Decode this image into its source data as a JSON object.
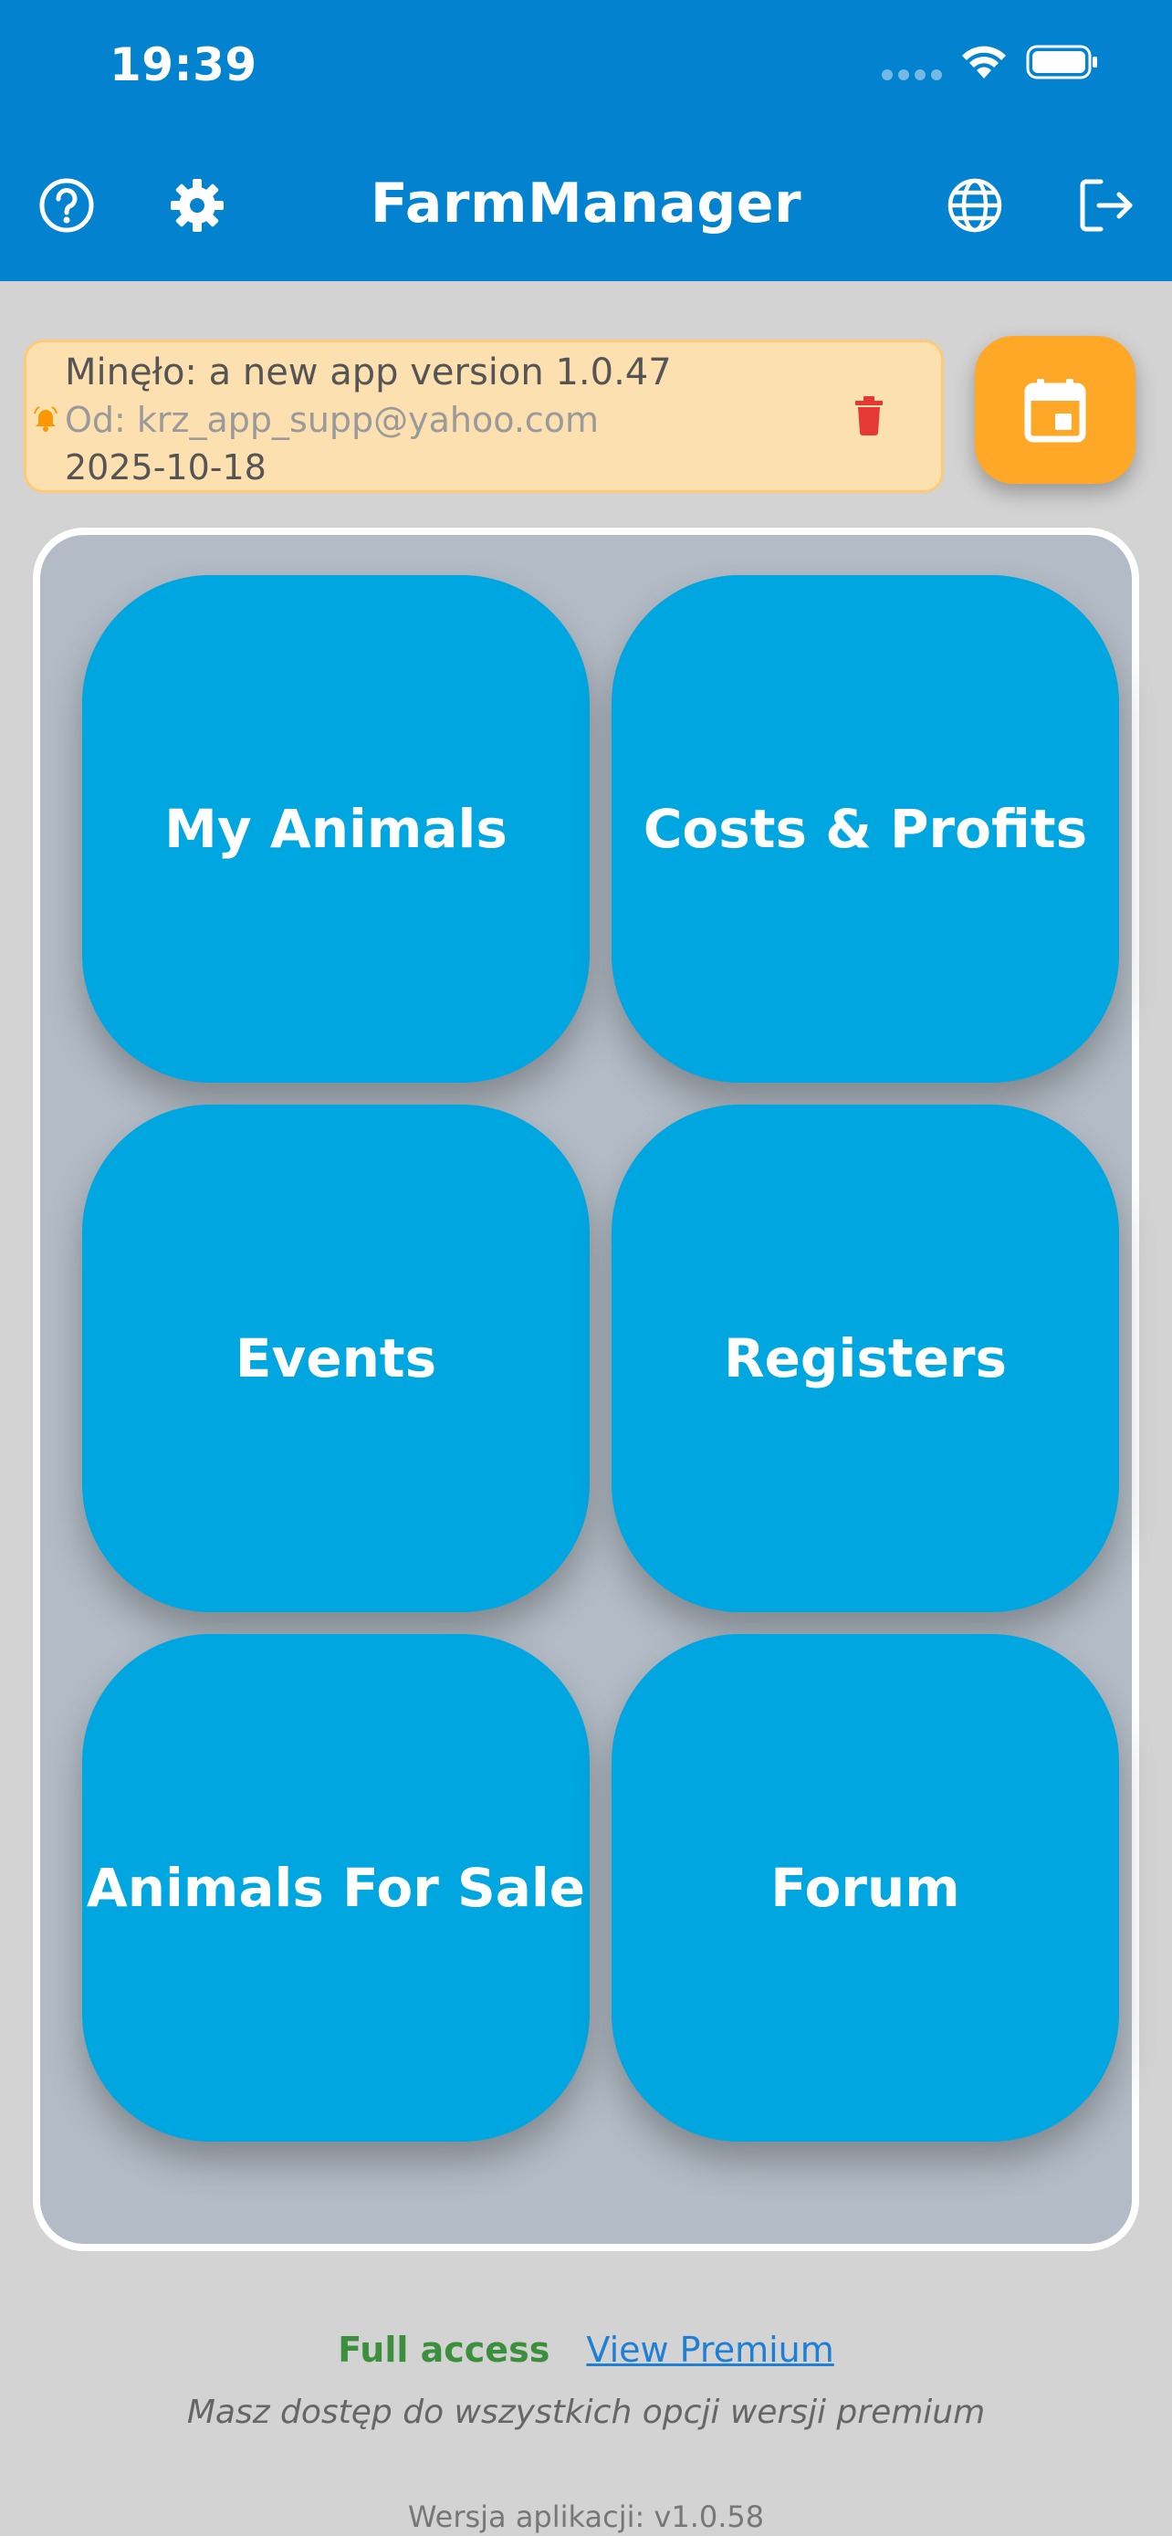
{
  "status_bar": {
    "time": "19:39"
  },
  "header": {
    "title": "FarmManager",
    "icons": [
      "help-icon",
      "settings-icon",
      "globe-icon",
      "logout-icon"
    ],
    "background": "#0382cf"
  },
  "notification": {
    "title": "Minęło: a new app version 1.0.47",
    "from": "Od: krz_app_supp@yahoo.com",
    "date": "2025-10-18",
    "background": "#fde0b0"
  },
  "calendar_button": {
    "icon": "calendar-icon",
    "color": "#ffa726"
  },
  "tiles": [
    {
      "label": "My Animals"
    },
    {
      "label": "Costs & Profits"
    },
    {
      "label": "Events"
    },
    {
      "label": "Registers"
    },
    {
      "label": "Animals For Sale"
    },
    {
      "label": "Forum"
    }
  ],
  "tile_color": "#00a6e0",
  "footer": {
    "access_status": "Full access",
    "premium_link": "View Premium",
    "note": "Masz dostęp do wszystkich opcji wersji premium",
    "version": "Wersja aplikacji: v1.0.58"
  }
}
